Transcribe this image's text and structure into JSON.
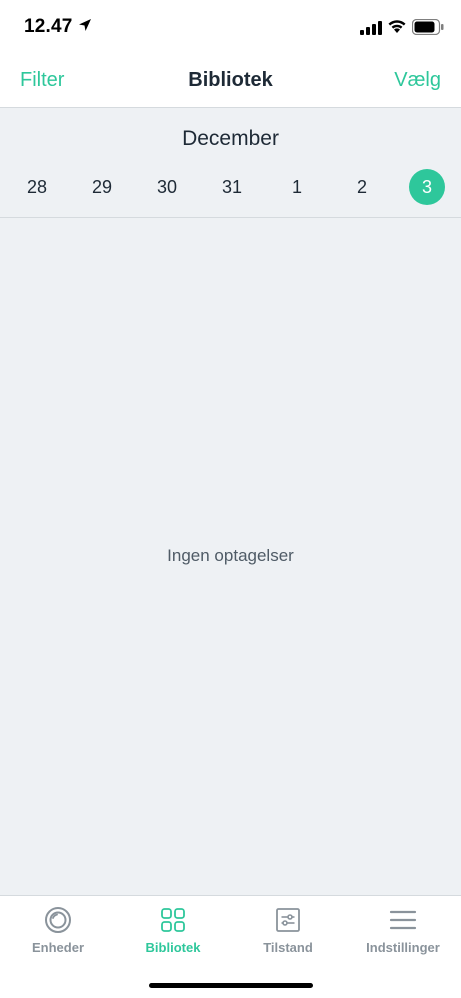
{
  "status_bar": {
    "time": "12.47",
    "icons": [
      "location-arrow-icon",
      "cellular-signal-icon",
      "wifi-icon",
      "battery-icon"
    ]
  },
  "nav": {
    "left_label": "Filter",
    "title": "Bibliotek",
    "right_label": "Vælg"
  },
  "calendar": {
    "month": "December",
    "days": [
      {
        "label": "28",
        "selected": false
      },
      {
        "label": "29",
        "selected": false
      },
      {
        "label": "30",
        "selected": false
      },
      {
        "label": "31",
        "selected": false
      },
      {
        "label": "1",
        "selected": false
      },
      {
        "label": "2",
        "selected": false
      },
      {
        "label": "3",
        "selected": true
      }
    ]
  },
  "empty_state": {
    "message": "Ingen optagelser"
  },
  "tab_bar": {
    "tabs": [
      {
        "label": "Enheder",
        "icon": "camera-lens-icon",
        "active": false
      },
      {
        "label": "Bibliotek",
        "icon": "grid-icon",
        "active": true
      },
      {
        "label": "Tilstand",
        "icon": "sliders-icon",
        "active": false
      },
      {
        "label": "Indstillinger",
        "icon": "menu-icon",
        "active": false
      }
    ]
  },
  "colors": {
    "accent": "#2ec79b",
    "background": "#eef1f4",
    "text": "#1e2a36",
    "inactive_tab": "#8a939b"
  }
}
